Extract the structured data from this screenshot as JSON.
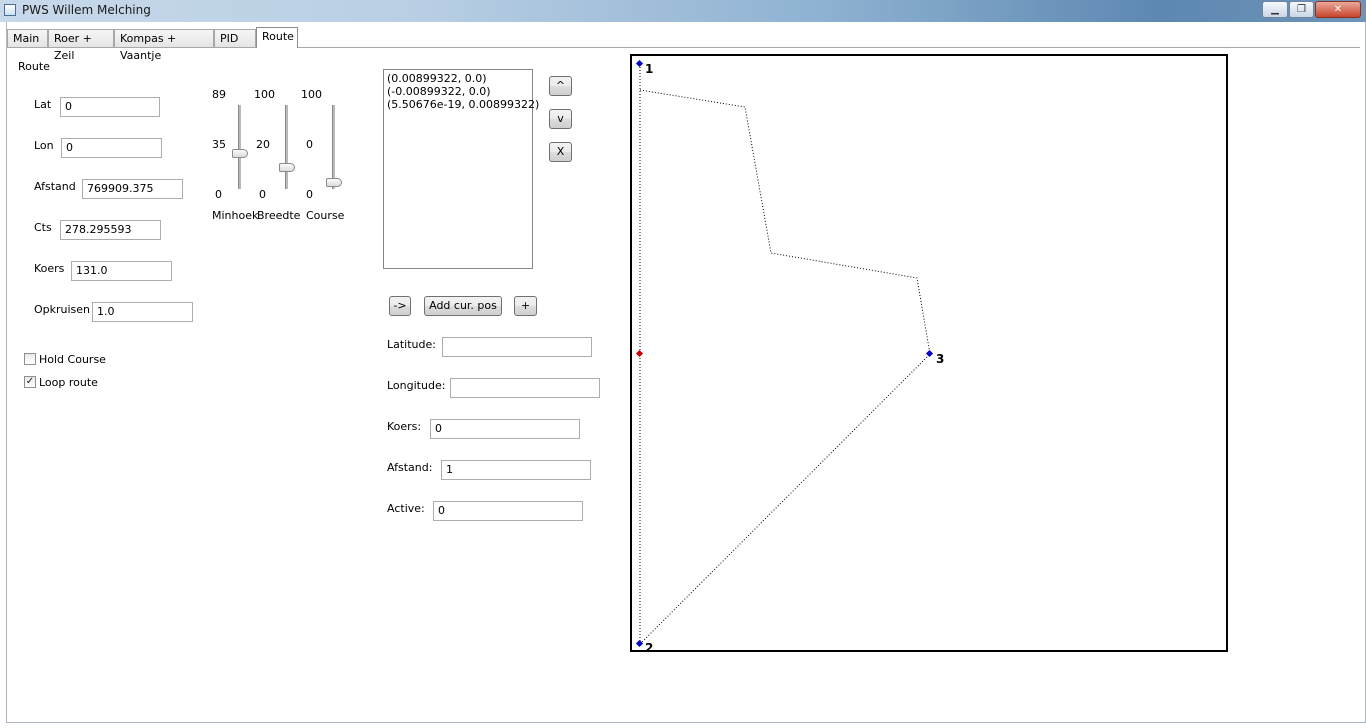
{
  "window": {
    "title": "PWS Willem Melching",
    "minimize": "▁",
    "maximize": "❐",
    "close": "✕"
  },
  "tabs": [
    "Main",
    "Roer + Zeil",
    "Kompas + Vaantje",
    "PID",
    "Route"
  ],
  "route_panel": {
    "heading": "Route",
    "fields": {
      "lat": {
        "label": "Lat",
        "value": "0"
      },
      "lon": {
        "label": "Lon",
        "value": "0"
      },
      "afstand": {
        "label": "Afstand",
        "value": "769909.375"
      },
      "cts": {
        "label": "Cts",
        "value": "278.295593"
      },
      "koers": {
        "label": "Koers",
        "value": "131.0"
      },
      "opkruisen": {
        "label": "Opkruisen",
        "value": "1.0"
      }
    },
    "hold_course": {
      "label": "Hold Course",
      "checked": false
    },
    "loop_route": {
      "label": "Loop route",
      "checked": true
    }
  },
  "sliders": [
    {
      "name": "Minhoek",
      "max": "100",
      "max_label": "89",
      "value": "35",
      "min": "0",
      "level": 0.35
    },
    {
      "name": "Breedte",
      "max": "100",
      "max_label": "100",
      "value": "20",
      "min": "0",
      "level": 0.2
    },
    {
      "name": "Course",
      "max": "100",
      "max_label": "100",
      "value": "0",
      "min": "0",
      "level": 0.0
    }
  ],
  "waypoint_list": [
    "(0.00899322, 0.0)",
    "(-0.00899322, 0.0)",
    "(5.50676e-19, 0.00899322)"
  ],
  "list_buttons": {
    "up": "^",
    "down": "v",
    "delete": "X"
  },
  "action_buttons": {
    "arrow": "->",
    "add_cur_pos": "Add cur. pos",
    "plus": "+"
  },
  "detail_fields": {
    "latitude": {
      "label": "Latitude:",
      "value": ""
    },
    "longitude": {
      "label": "Longitude:",
      "value": ""
    },
    "koers": {
      "label": "Koers:",
      "value": "0"
    },
    "afstand": {
      "label": "Afstand:",
      "value": "1"
    },
    "active": {
      "label": "Active:",
      "value": "0"
    }
  },
  "map": {
    "waypoints": [
      "1",
      "2",
      "3"
    ],
    "colors": {
      "waypoint": "#0000cc",
      "boat": "#cc0000",
      "track": "#000000"
    }
  }
}
